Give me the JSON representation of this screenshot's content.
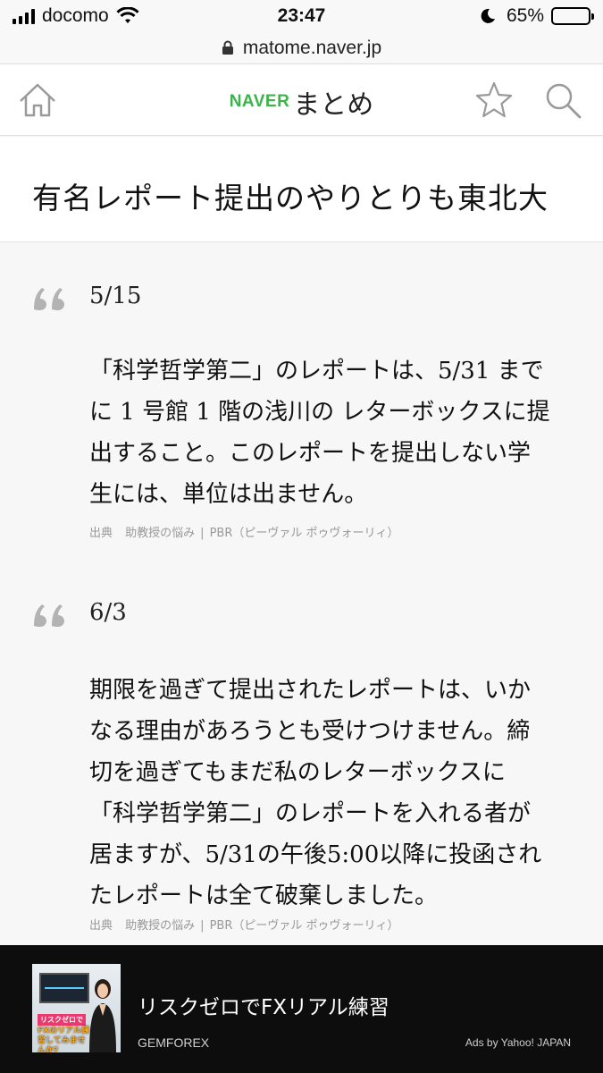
{
  "status_bar": {
    "carrier": "docomo",
    "time": "23:47",
    "battery_text": "65%",
    "battery_level": 0.65
  },
  "browser": {
    "url": "matome.naver.jp"
  },
  "header": {
    "logo_naver": "NAVER",
    "logo_matome": "まとめ"
  },
  "page": {
    "title": "有名レポート提出のやりとりも東北大"
  },
  "quotes": [
    {
      "date": "5/15",
      "lines": [
        "「科学哲学第二」のレポートは、5/31 まで",
        "に 1 号館 1 階の浅川の レターボックスに提",
        "出すること。このレポートを提出しない学",
        "生には、単位は出ません。"
      ],
      "source_label": "出典",
      "source_title": "助教授の悩み",
      "source_sep": "|",
      "source_site": "PBR（ピーヴァル ポゥヴォーリィ）"
    },
    {
      "date": "6/3",
      "lines": [
        "期限を過ぎて提出されたレポートは、いか",
        "なる理由があろうとも受けつけません。締",
        "切を過ぎてもまだ私のレターボックスに",
        "「科学哲学第二」のレポートを入れる者が",
        "居ますが、5/31の午後5:00以降に投函され",
        "たレポートは全て破棄しました。"
      ],
      "source_label": "出典",
      "source_title": "助教授の悩み",
      "source_sep": "|",
      "source_site": "PBR（ピーヴァル ポゥヴォーリィ）"
    }
  ],
  "ad": {
    "image_label_1": "リスクゼロで",
    "image_label_2": "FXのリアル練習してみませんか?",
    "title": "リスクゼロでFXリアル練習",
    "advertiser": "GEMFOREX",
    "credit": "Ads by Yahoo! JAPAN"
  },
  "icons": {
    "home": "home-icon",
    "star": "star-icon",
    "search": "search-icon",
    "quote": "quote-icon"
  },
  "colors": {
    "naver_green": "#3bb44a",
    "ad_background": "#0d0d0d"
  }
}
